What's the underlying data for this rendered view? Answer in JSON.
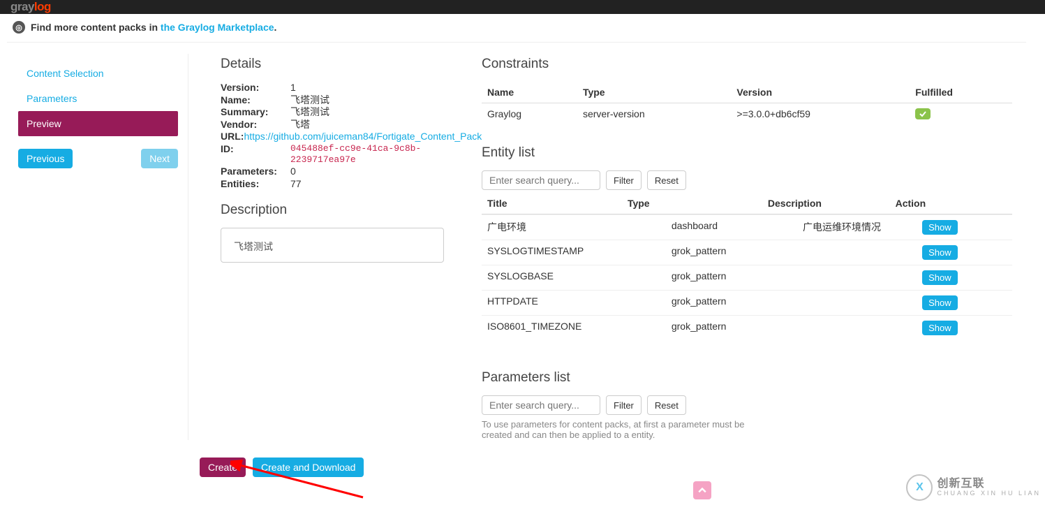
{
  "brand": {
    "part1": "gray",
    "part2": "log"
  },
  "banner": {
    "prefix": "Find more content packs in ",
    "link_text": "the Graylog Marketplace",
    "suffix": "."
  },
  "sidebar": {
    "items": [
      {
        "label": "Content Selection",
        "active": false
      },
      {
        "label": "Parameters",
        "active": false
      },
      {
        "label": "Preview",
        "active": true
      }
    ],
    "prev": "Previous",
    "next": "Next"
  },
  "details": {
    "heading": "Details",
    "rows": {
      "version_label": "Version:",
      "version": "1",
      "name_label": "Name:",
      "name": "飞塔测试",
      "summary_label": "Summary:",
      "summary": "飞塔测试",
      "vendor_label": "Vendor:",
      "vendor": "飞塔",
      "url_label": "URL:",
      "url": "https://github.com/juiceman84/Fortigate_Content_Pack",
      "id_label": "ID:",
      "id": "045488ef-cc9e-41ca-9c8b-2239717ea97e",
      "parameters_label": "Parameters:",
      "parameters": "0",
      "entities_label": "Entities:",
      "entities": "77"
    },
    "description_heading": "Description",
    "description_text": "飞塔测试"
  },
  "constraints": {
    "heading": "Constraints",
    "headers": {
      "name": "Name",
      "type": "Type",
      "version": "Version",
      "fulfilled": "Fulfilled"
    },
    "rows": [
      {
        "name": "Graylog",
        "type": "server-version",
        "version": ">=3.0.0+db6cf59",
        "fulfilled": true
      }
    ]
  },
  "entity_list": {
    "heading": "Entity list",
    "placeholder": "Enter search query...",
    "filter": "Filter",
    "reset": "Reset",
    "headers": {
      "title": "Title",
      "type": "Type",
      "description": "Description",
      "action": "Action"
    },
    "show": "Show",
    "rows": [
      {
        "title": "广电环境",
        "type": "dashboard",
        "description": "广电运维环境情况"
      },
      {
        "title": "SYSLOGTIMESTAMP",
        "type": "grok_pattern",
        "description": ""
      },
      {
        "title": "SYSLOGBASE",
        "type": "grok_pattern",
        "description": ""
      },
      {
        "title": "HTTPDATE",
        "type": "grok_pattern",
        "description": ""
      },
      {
        "title": "ISO8601_TIMEZONE",
        "type": "grok_pattern",
        "description": ""
      }
    ]
  },
  "parameters_list": {
    "heading": "Parameters list",
    "placeholder": "Enter search query...",
    "filter": "Filter",
    "reset": "Reset",
    "hint": "To use parameters for content packs, at first a parameter must be created and can then be applied to a entity."
  },
  "footer": {
    "create": "Create",
    "create_download": "Create and Download"
  },
  "watermark": {
    "main": "创新互联",
    "sub": "CHUANG XIN HU LIAN"
  }
}
